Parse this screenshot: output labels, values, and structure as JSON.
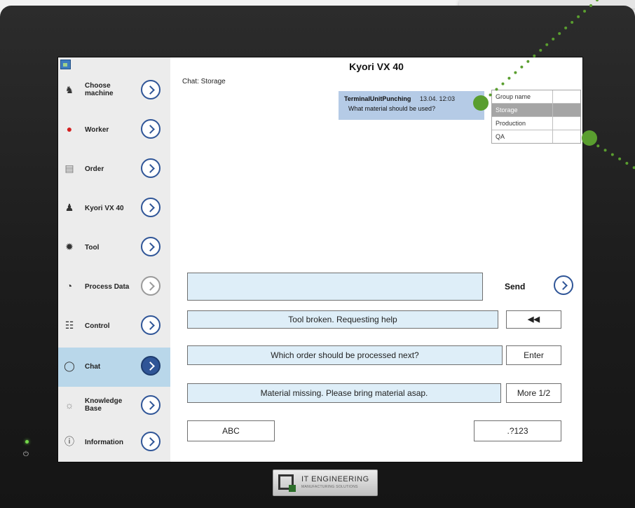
{
  "app": {
    "title": "Kyori VX 40",
    "chat_label": "Chat: Storage"
  },
  "sidebar": {
    "items": [
      {
        "label": "Choose machine",
        "icon": "machine-icon",
        "arrow": "normal"
      },
      {
        "label": "Worker",
        "icon": "worker-icon",
        "arrow": "normal"
      },
      {
        "label": "Order",
        "icon": "order-icon",
        "arrow": "normal"
      },
      {
        "label": "Kyori VX 40",
        "icon": "operator-icon",
        "arrow": "normal"
      },
      {
        "label": "Tool",
        "icon": "gear-icon",
        "arrow": "normal"
      },
      {
        "label": "Process Data",
        "icon": "gauge-icon",
        "arrow": "disabled"
      },
      {
        "label": "Control",
        "icon": "checklist-icon",
        "arrow": "normal"
      },
      {
        "label": "Chat",
        "icon": "chat-bubble-icon",
        "arrow": "active"
      },
      {
        "label": "Knowledge Base",
        "icon": "lightbulb-icon",
        "arrow": "normal"
      },
      {
        "label": "Information",
        "icon": "info-icon",
        "arrow": "normal"
      }
    ]
  },
  "message": {
    "sender": "TerminalUnitPunching",
    "time": "13.04.  12:03",
    "text": "What material should be used?"
  },
  "groups": {
    "header": "Group name",
    "rows": [
      "Storage",
      "Production",
      "QA"
    ],
    "selected": "Storage"
  },
  "compose": {
    "input_value": "",
    "send_label": "Send",
    "quick_replies": [
      "Tool broken. Requesting help",
      "Which order should be processed next?",
      "Material missing. Please bring material asap."
    ],
    "back_symbol": "◀◀",
    "enter_label": "Enter",
    "more_label": "More  1/2",
    "abc_label": "ABC",
    "num_label": ".?123"
  },
  "device": {
    "brand": "IT ENGINEERING",
    "brand_sub": "MANUFACTURING SOLUTIONS"
  },
  "colors": {
    "accent": "#2f5597",
    "active_nav": "#b9d7ea",
    "message_bg": "#b5cbe6",
    "field_bg": "#deeef8",
    "callout_dot": "#5a9e2f"
  }
}
